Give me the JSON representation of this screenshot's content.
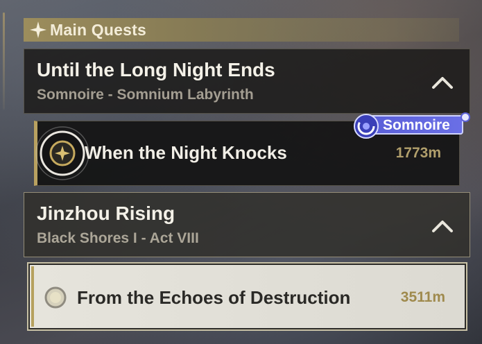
{
  "section": {
    "title": "Main Quests",
    "icon": "sparkle-star-icon"
  },
  "quests": [
    {
      "title": "Until the Long Night Ends",
      "subtitle": "Somnoire - Somnium Labyrinth",
      "expanded": true,
      "task": {
        "name": "When the Night Knocks",
        "distance": "1773m",
        "tracked": true,
        "icon": "tracked-quest-marker-icon"
      },
      "badge": {
        "label": "Somnoire",
        "icon": "somnoire-swirl-icon"
      }
    },
    {
      "title": "Jinzhou Rising",
      "subtitle": "Black Shores I - Act VIII",
      "expanded": true,
      "task": {
        "name": "From the Echoes of Destruction",
        "distance": "3511m",
        "selected": true,
        "icon": "quest-radio-icon"
      }
    }
  ],
  "colors": {
    "accent_gold": "#b8a160",
    "badge_blue": "#5a5fd8",
    "header_gold": "#9c8d5c"
  }
}
